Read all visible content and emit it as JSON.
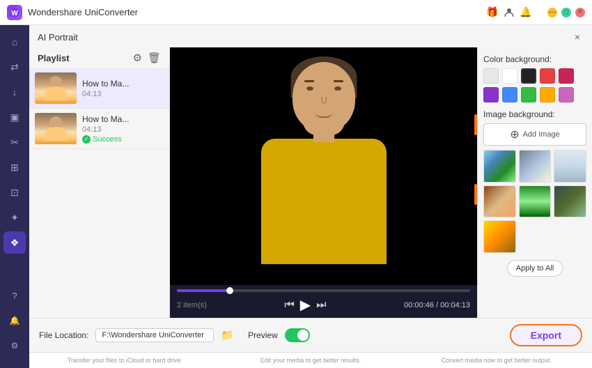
{
  "app": {
    "title": "Wondershare UniConverter",
    "logo_letter": "W"
  },
  "titlebar": {
    "icons": [
      "gift-icon",
      "user-icon",
      "bell-icon"
    ],
    "controls": [
      "minimize-btn",
      "maximize-btn",
      "close-btn"
    ]
  },
  "sidebar": {
    "items": [
      {
        "id": "home",
        "icon": "⌂",
        "active": false
      },
      {
        "id": "convert",
        "icon": "⇄",
        "active": false
      },
      {
        "id": "download",
        "icon": "↓",
        "active": false
      },
      {
        "id": "screen",
        "icon": "▣",
        "active": false
      },
      {
        "id": "scissors",
        "icon": "✂",
        "active": false
      },
      {
        "id": "grid",
        "icon": "⊞",
        "active": false
      },
      {
        "id": "compress",
        "icon": "⊡",
        "active": false
      },
      {
        "id": "effects",
        "icon": "✦",
        "active": false
      },
      {
        "id": "ai",
        "icon": "❖",
        "active": true
      }
    ],
    "bottom": [
      {
        "id": "help",
        "icon": "?"
      },
      {
        "id": "notif",
        "icon": "🔔"
      },
      {
        "id": "settings",
        "icon": "⚙"
      }
    ]
  },
  "panel": {
    "title": "AI Portrait",
    "close_label": "×"
  },
  "playlist": {
    "title": "Playlist",
    "items": [
      {
        "name": "How to Ma...",
        "duration": "04:13",
        "status": null,
        "active": true
      },
      {
        "name": "How to Ma...",
        "duration": "04:13",
        "status": "Success",
        "active": false
      }
    ]
  },
  "video": {
    "current_time": "00:00:46",
    "total_time": "00:04:13",
    "progress_percent": 18
  },
  "controls": {
    "prev_icon": "⏮",
    "play_icon": "▶",
    "next_icon": "⏭",
    "items_count": "2 item(s)"
  },
  "bottom_bar": {
    "file_location_label": "File Location:",
    "file_location_value": "F:\\Wondershare UniConverter",
    "preview_label": "Preview",
    "export_label": "Export"
  },
  "right_panel": {
    "color_bg_label": "Color background:",
    "colors": [
      {
        "hex": "#e8e8e8",
        "selected": false
      },
      {
        "hex": "#ffffff",
        "selected": false
      },
      {
        "hex": "#222222",
        "selected": true
      },
      {
        "hex": "#e84040",
        "selected": false
      },
      {
        "hex": "#cc2255",
        "selected": false
      },
      {
        "hex": "#8833cc",
        "selected": false
      },
      {
        "hex": "#4488ff",
        "selected": false
      },
      {
        "hex": "#33bb44",
        "selected": false
      },
      {
        "hex": "#ffaa00",
        "selected": false
      },
      {
        "hex": "#cc66bb",
        "selected": false
      }
    ],
    "image_bg_label": "Image background:",
    "add_image_label": "Add Image",
    "apply_all_label": "Apply to All",
    "promo": [
      "Transfer your files to iCloud or hard drive.",
      "Edit your media to get better results.",
      "Convert media now to get better output."
    ]
  }
}
